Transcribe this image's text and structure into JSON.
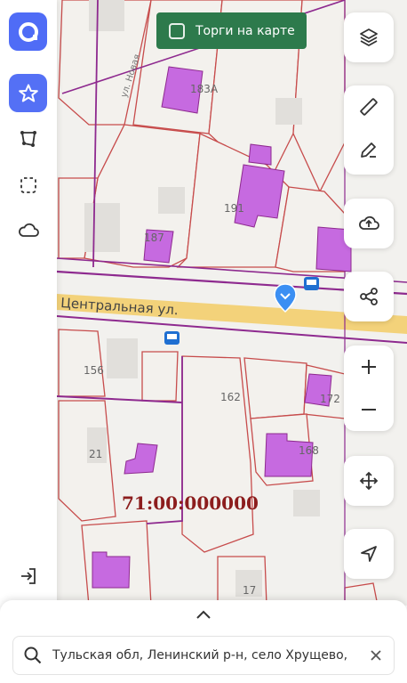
{
  "map": {
    "street_label": "Центральная ул.",
    "side_street_label": "ул. Новая",
    "cadastral_number": "71:00:000000",
    "parcels": [
      {
        "label": "183А"
      },
      {
        "label": "191"
      },
      {
        "label": "187"
      },
      {
        "label": "156"
      },
      {
        "label": "162"
      },
      {
        "label": "172"
      },
      {
        "label": "168"
      },
      {
        "label": "21"
      },
      {
        "label": "17"
      }
    ],
    "bus_stop_label": "🚌",
    "colors": {
      "parcel_border": "#c74c4c",
      "building_fill": "#c66ae0",
      "boundary": "#8e2a8f",
      "road": "#f3d27a",
      "marker": "#3b8ff3"
    }
  },
  "torgi": {
    "label": "Торги на карте",
    "checked": false
  },
  "left_rail": {
    "logo_icon": "logo-icon",
    "items": [
      {
        "name": "favorites",
        "icon": "star-icon",
        "active": true
      },
      {
        "name": "polygon",
        "icon": "polygon-icon",
        "active": false
      },
      {
        "name": "select-area",
        "icon": "dashed-square-icon",
        "active": false
      },
      {
        "name": "cloud",
        "icon": "cloud-icon",
        "active": false
      }
    ],
    "login_icon": "login-icon"
  },
  "right_tools": [
    "layers-icon",
    "ruler-icon",
    "pencil-icon",
    "cloud-upload-icon",
    "share-icon",
    "zoom-in-icon",
    "zoom-out-icon",
    "move-icon",
    "locate-icon"
  ],
  "search": {
    "value": "Тульская обл, Ленинский р-н, село Хрущево,"
  }
}
